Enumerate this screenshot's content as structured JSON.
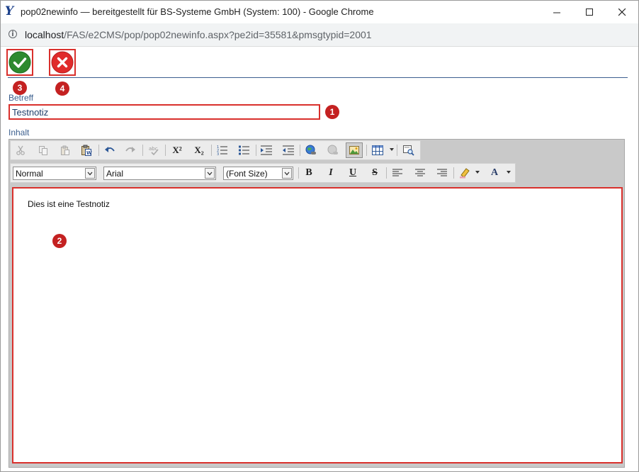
{
  "titlebar": {
    "app_icon": "Y",
    "title": "pop02newinfo — bereitgestellt für BS-Systeme GmbH (System: 100) - Google Chrome"
  },
  "address_bar": {
    "host": "localhost",
    "path": "/FAS/e2CMS/pop/pop02newinfo.aspx?pe2id=35581&pmsgtypid=2001"
  },
  "actions": {
    "confirm_icon": "checkmark-icon",
    "cancel_icon": "x-icon",
    "confirm_badge": "3",
    "cancel_badge": "4"
  },
  "form": {
    "subject_label": "Betreff",
    "subject_value": "Testnotiz",
    "subject_badge": "1",
    "content_label": "Inhalt",
    "content_text": "Dies ist eine Testnotiz",
    "content_badge": "2"
  },
  "editor_toolbar": {
    "format_value": "Normal",
    "font_value": "Arial",
    "size_value": "(Font Size)",
    "bold": "B",
    "italic": "I",
    "underline": "U",
    "strike": "S",
    "superscript": "X²",
    "subscript": "X₂",
    "font_color": "A"
  },
  "colors": {
    "annotation_red": "#d9302c",
    "badge_red": "#c42121",
    "confirm_green": "#2e8a2f",
    "cancel_red": "#e02b2b",
    "label_blue": "#3c5f8e"
  }
}
